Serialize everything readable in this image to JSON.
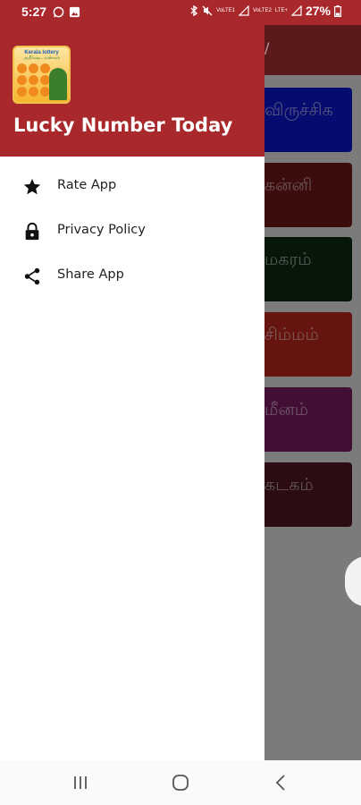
{
  "status_bar": {
    "time": "5:27",
    "signal_1": "VoLTE1",
    "signal_2": "VoLTE2",
    "network": "LTE+",
    "battery": "27%"
  },
  "drawer": {
    "app_title": "Lucky Number Today",
    "logo": {
      "title": "Kerala lottery",
      "subtitle": "அதிர்ஷ்ட எண்கள்"
    },
    "menu": [
      {
        "label": "Rate App",
        "icon": "star-icon"
      },
      {
        "label": "Privacy Policy",
        "icon": "lock-icon"
      },
      {
        "label": "Share App",
        "icon": "share-icon"
      }
    ]
  },
  "background": {
    "cards": [
      {
        "label": "விருச்சிக",
        "color": "#0a14c9"
      },
      {
        "label": "கன்னி",
        "color": "#6e1717"
      },
      {
        "label": "மகரம்",
        "color": "#0a2a12"
      },
      {
        "label": "சிம்மம்",
        "color": "#b8241c"
      },
      {
        "label": "மீனம்",
        "color": "#7a1a5e"
      },
      {
        "label": "கடகம்",
        "color": "#4d1620"
      }
    ]
  },
  "colors": {
    "primary": "#a9282c",
    "scrim": "#7b7b7b"
  }
}
